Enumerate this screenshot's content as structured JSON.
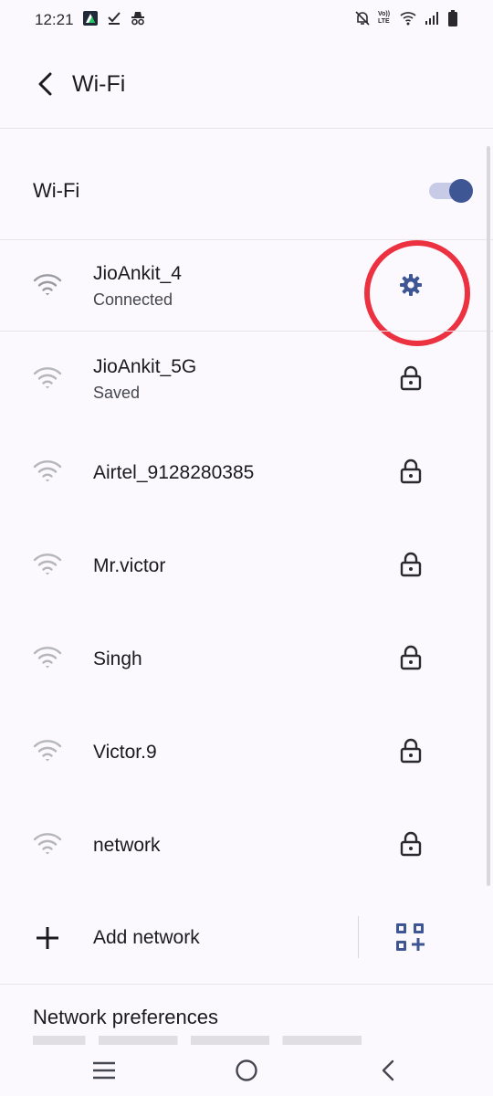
{
  "status_bar": {
    "time": "12:21",
    "left_icons": [
      "app-notification-icon",
      "check-download-icon",
      "incognito-icon"
    ],
    "right_icons": [
      "bell-off-icon",
      "volte-icon",
      "wifi-status-icon",
      "cellular-signal-icon",
      "battery-icon"
    ],
    "volte_text": "Vo)) LTE"
  },
  "header": {
    "back_icon": "chevron-left-icon",
    "title": "Wi-Fi"
  },
  "wifi_toggle": {
    "label": "Wi-Fi",
    "state": "on",
    "accent_color": "#3f5695"
  },
  "networks": [
    {
      "name": "JioAnkit_4",
      "status": "Connected",
      "action_icon": "gear-icon",
      "wifi_icon": "wifi-icon"
    },
    {
      "name": "JioAnkit_5G",
      "status": "Saved",
      "action_icon": "lock-icon",
      "wifi_icon": "wifi-icon"
    },
    {
      "name": "Airtel_9128280385",
      "status": "",
      "action_icon": "lock-icon",
      "wifi_icon": "wifi-icon"
    },
    {
      "name": "Mr.victor",
      "status": "",
      "action_icon": "lock-icon",
      "wifi_icon": "wifi-icon"
    },
    {
      "name": "Singh",
      "status": "",
      "action_icon": "lock-icon",
      "wifi_icon": "wifi-icon"
    },
    {
      "name": "Victor.9",
      "status": "",
      "action_icon": "lock-icon",
      "wifi_icon": "wifi-icon"
    },
    {
      "name": "network",
      "status": "",
      "action_icon": "lock-icon",
      "wifi_icon": "wifi-icon"
    }
  ],
  "add_network": {
    "label": "Add network",
    "plus_icon": "plus-icon",
    "qr_icon": "qr-code-scan-icon"
  },
  "preferences": {
    "title": "Network preferences"
  },
  "highlight": {
    "color": "#ec3140"
  },
  "nav_bar": {
    "menu_icon": "menu-icon",
    "home_icon": "home-circle-icon",
    "back_icon": "back-chevron-icon"
  }
}
